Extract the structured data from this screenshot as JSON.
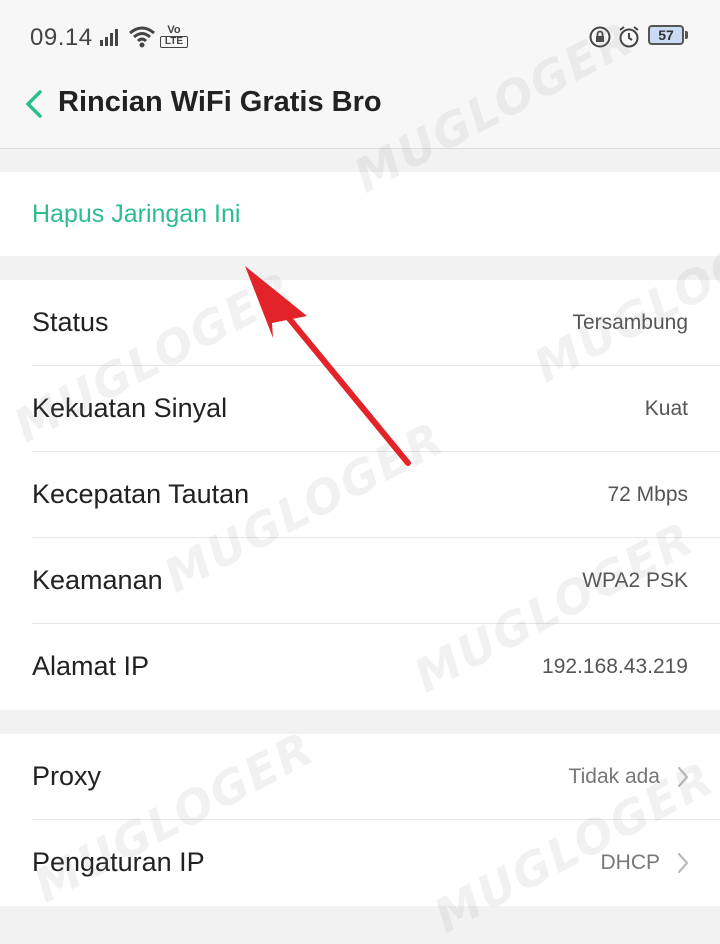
{
  "status_bar": {
    "time": "09.14",
    "volte_top": "Vo",
    "volte_bottom": "LTE",
    "battery": "57",
    "icons": [
      "signal-icon",
      "wifi-icon",
      "volte-icon",
      "lock-rotation-icon",
      "alarm-icon",
      "battery-icon"
    ]
  },
  "header": {
    "back_icon": "chevron-left-icon",
    "title": "Rincian WiFi Gratis Bro"
  },
  "forget_network": {
    "label": "Hapus Jaringan Ini"
  },
  "info_rows": [
    {
      "label": "Status",
      "value": "Tersambung"
    },
    {
      "label": "Kekuatan Sinyal",
      "value": "Kuat"
    },
    {
      "label": "Kecepatan Tautan",
      "value": "72 Mbps"
    },
    {
      "label": "Keamanan",
      "value": "WPA2 PSK"
    },
    {
      "label": "Alamat IP",
      "value": "192.168.43.219"
    }
  ],
  "settings_rows": [
    {
      "label": "Proxy",
      "value": "Tidak ada"
    },
    {
      "label": "Pengaturan IP",
      "value": "DHCP"
    }
  ],
  "colors": {
    "accent": "#2bbd8e",
    "annotation_arrow": "#e3232a",
    "background": "#f2f2f2",
    "card": "#ffffff"
  },
  "watermark": {
    "text": "MUGLOGER"
  }
}
